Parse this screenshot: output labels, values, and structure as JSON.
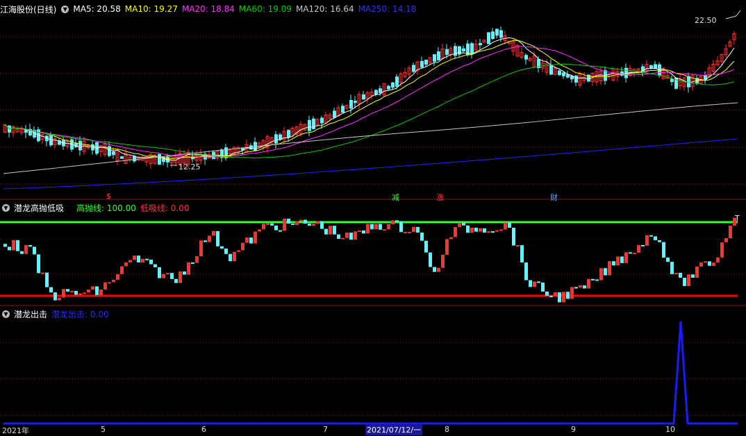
{
  "colors": {
    "background": "#000000",
    "grid": "#8b1a1a",
    "up_candle": "#ff3333",
    "down_candle": "#54ffff",
    "ma5": "#ffffff",
    "ma10": "#ffff00",
    "ma20": "#ff33ff",
    "ma60": "#00cc00",
    "ma120": "#c8c8c8",
    "ma250": "#2222ff",
    "high_line": "#33ff33",
    "low_line": "#ff0000",
    "signal_line": "#1a1aff"
  },
  "main_panel": {
    "title": "江海股份(日线)",
    "collapse_icon": "chevron-down-icon",
    "ma_labels": [
      {
        "text": "MA5: 20.58",
        "color": "#ffffff"
      },
      {
        "text": "MA10: 19.27",
        "color": "#ffff00"
      },
      {
        "text": "MA20: 18.84",
        "color": "#ff33ff"
      },
      {
        "text": "MA60: 19.09",
        "color": "#00cc00"
      },
      {
        "text": "MA120: 16.64",
        "color": "#c8c8c8"
      },
      {
        "text": "MA250: 14.18",
        "color": "#2222ff"
      }
    ],
    "high_price_label": "22.50",
    "low_price_label": "12.25",
    "event_markers": [
      {
        "text": "$",
        "color": "#ff4444"
      },
      {
        "text": "减",
        "color": "#33ff33"
      },
      {
        "text": "涨",
        "color": "#ff4444"
      },
      {
        "text": "财",
        "color": "#66aaff"
      }
    ]
  },
  "indicator1": {
    "name": "潜龙高抛低吸",
    "high_label": "高抛线: 100.00",
    "low_label": "低吸线: 0.00",
    "end_marker": "T"
  },
  "indicator2": {
    "name": "潜龙出击",
    "value_label": "潜龙出击: 0.00"
  },
  "date_axis": {
    "labels": [
      "2021年",
      "5",
      "6",
      "7",
      "2021/07/12/一",
      "8",
      "9",
      "10"
    ]
  }
}
